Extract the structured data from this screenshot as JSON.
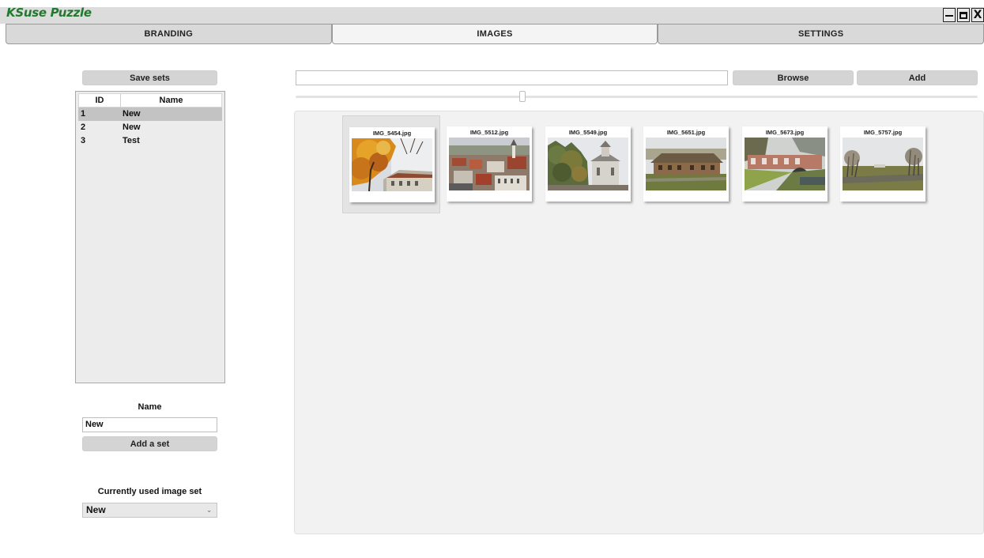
{
  "app": {
    "title": "KSuse Puzzle",
    "window_controls": {
      "minimize": "minimize-icon",
      "maximize": "maximize-icon",
      "close": "X"
    }
  },
  "tabs": [
    {
      "label": "BRANDING",
      "active": false
    },
    {
      "label": "IMAGES",
      "active": true
    },
    {
      "label": "SETTINGS",
      "active": false
    }
  ],
  "left_panel": {
    "save_label": "Save sets",
    "table": {
      "columns": [
        "ID",
        "Name"
      ],
      "rows": [
        {
          "id": "1",
          "name": "New",
          "selected": true
        },
        {
          "id": "2",
          "name": "New",
          "selected": false
        },
        {
          "id": "3",
          "name": "Test",
          "selected": false
        }
      ]
    },
    "name_label": "Name",
    "name_value": "New",
    "add_set_label": "Add a set",
    "used_label": "Currently used image set",
    "used_value": "New"
  },
  "right_panel": {
    "path_value": "",
    "browse_label": "Browse",
    "add_label": "Add",
    "zoom_fraction": 0.33,
    "images": [
      {
        "name": "IMG_5454.jpg",
        "selected": true
      },
      {
        "name": "IMG_5512.jpg",
        "selected": false
      },
      {
        "name": "IMG_5549.jpg",
        "selected": false
      },
      {
        "name": "IMG_5651.jpg",
        "selected": false
      },
      {
        "name": "IMG_5673.jpg",
        "selected": false
      },
      {
        "name": "IMG_5757.jpg",
        "selected": false
      }
    ]
  },
  "colors": {
    "title_green": "#1f7a2e",
    "tab_bg": "#d9d9d9",
    "tab_active_bg": "#f4f4f4",
    "selection": "#c3c3c3"
  }
}
